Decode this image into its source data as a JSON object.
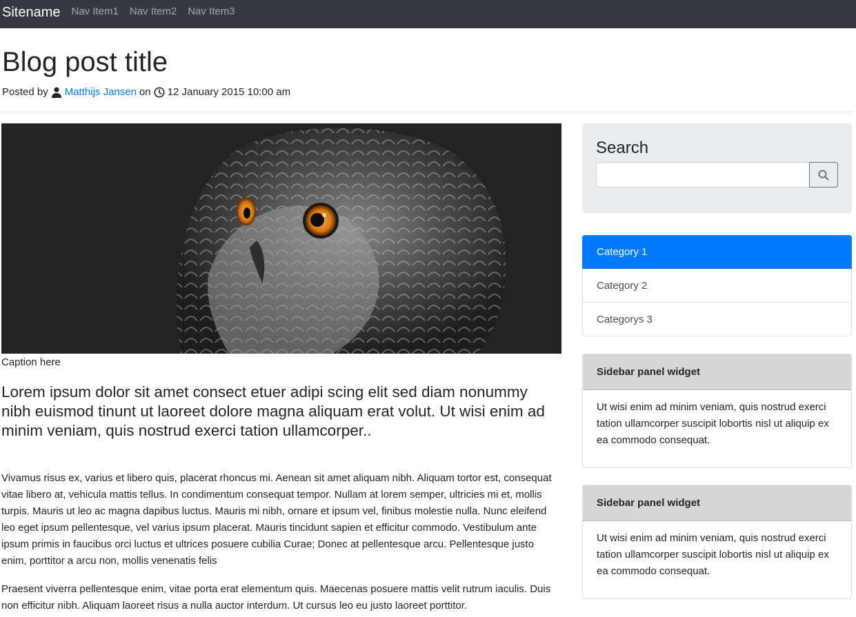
{
  "navbar": {
    "brand": "Sitename",
    "items": [
      "Nav Item1",
      "Nav Item2",
      "Nav Item3"
    ]
  },
  "post": {
    "title": "Blog post title",
    "posted_by": "Posted by",
    "author": "Matthijs Jansen",
    "on": "on",
    "date": "12 January 2015 10:00 am",
    "caption": "Caption here",
    "lead": "Lorem ipsum dolor sit amet consect etuer adipi scing elit sed diam nonummy nibh euismod tinunt ut laoreet dolore magna aliquam erat volut. Ut wisi enim ad minim veniam, quis nostrud exerci tation ullamcorper..",
    "paragraph1": "Vivamus risus ex, varius et libero quis, placerat rhoncus mi. Aenean sit amet aliquam nibh. Aliquam tortor est, consequat vitae libero at, vehicula mattis tellus. In condimentum consequat tempor. Nullam at lorem semper, ultricies mi et, mollis turpis. Mauris ut leo ac magna dapibus luctus. Mauris mi nibh, ornare et ipsum vel, finibus molestie nulla. Nunc eleifend leo eget ipsum pellentesque, vel varius ipsum placerat. Mauris tincidunt sapien et efficitur commodo. Vestibulum ante ipsum primis in faucibus orci luctus et ultrices posuere cubilia Curae; Donec at pellentesque arcu. Pellentesque justo enim, porttitor a arcu non, mollis venenatis felis",
    "paragraph2": "Praesent viverra pellentesque enim, vitae porta erat elementum quis. Maecenas posuere mattis velit rutrum iaculis. Duis non efficitur nibh. Aliquam laoreet risus a nulla auctor interdum. Ut cursus leo eu justo laoreet porttitor."
  },
  "sidebar": {
    "search": {
      "title": "Search",
      "placeholder": "",
      "value": ""
    },
    "categories": [
      "Category 1",
      "Category 2",
      "Categorys 3"
    ],
    "active_category": "Category 1",
    "widgets": [
      {
        "title": "Sidebar panel widget",
        "body": "Ut wisi enim ad minim veniam, quis nostrud exerci tation ullamcorper suscipit lobortis nisl ut aliquip ex ea commodo consequat."
      },
      {
        "title": "Sidebar panel widget",
        "body": "Ut wisi enim ad minim veniam, quis nostrud exerci tation ullamcorper suscipit lobortis nisl ut aliquip ex ea commodo consequat."
      }
    ]
  },
  "icons": {
    "author": "user-icon",
    "date": "clock-icon",
    "search": "search-icon"
  },
  "colors": {
    "navbar_bg": "#343a40",
    "link": "#007bff",
    "active_category_bg": "#007bff",
    "search_panel_bg": "#e9ecef",
    "widget_header_bg": "#d6d6d6"
  }
}
